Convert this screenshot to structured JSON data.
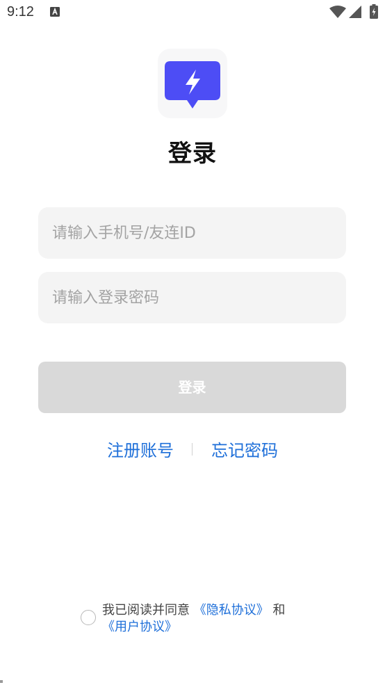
{
  "status_bar": {
    "time": "9:12",
    "notification_icon": "text-a-icon",
    "wifi_icon": "wifi-icon",
    "signal_icon": "signal-icon",
    "battery_icon": "battery-charging-icon"
  },
  "logo": {
    "icon": "lightning-chat-bubble-icon",
    "color": "#4d4df5"
  },
  "title": "登录",
  "form": {
    "account_placeholder": "请输入手机号/友连ID",
    "account_value": "",
    "password_placeholder": "请输入登录密码",
    "password_value": "",
    "login_label": "登录"
  },
  "links": {
    "register": "注册账号",
    "forgot": "忘记密码"
  },
  "agreement": {
    "prefix": "我已阅读并同意",
    "privacy": "《隐私协议》",
    "and": "和",
    "user": "《用户协议》"
  },
  "colors": {
    "accent": "#1e6fd9",
    "logo_purple": "#4d4df5",
    "button_disabled": "#d9d9d9",
    "field_background": "#f4f4f4"
  }
}
